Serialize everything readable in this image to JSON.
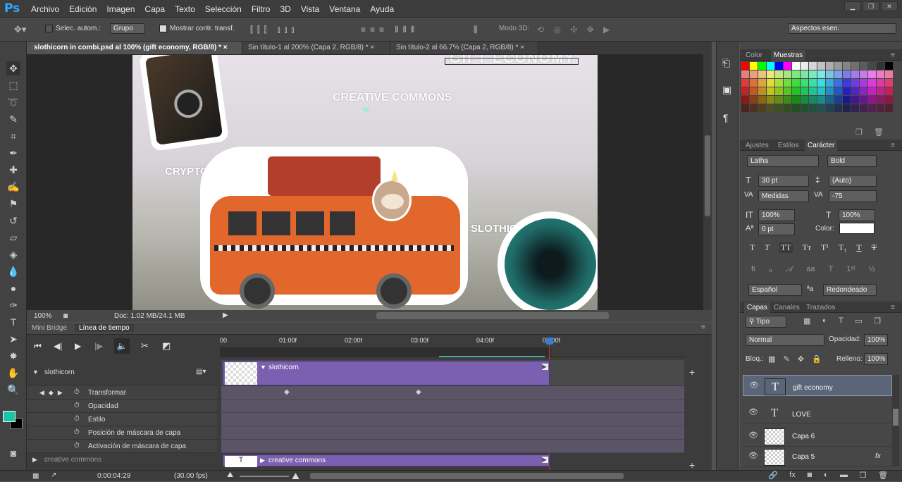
{
  "app": {
    "logo": "Ps"
  },
  "menu": [
    "Archivo",
    "Edición",
    "Imagen",
    "Capa",
    "Texto",
    "Selección",
    "Filtro",
    "3D",
    "Vista",
    "Ventana",
    "Ayuda"
  ],
  "options": {
    "auto_select_label": "Selec. autom.:",
    "group_value": "Grupo",
    "show_transform_label": "Mostrar contr. transf.",
    "mode3d_label": "Modo 3D:",
    "workspace": "Aspectos esen."
  },
  "doc_tabs": [
    {
      "label": "slothicorn in combi.psd al 100% (gift economy, RGB/8) *",
      "close": "×"
    },
    {
      "label": "Sin título-1 al 200% (Capa 2, RGB/8) *",
      "close": "×"
    },
    {
      "label": "Sin título-2 al 66.7% (Capa 2, RGB/8) *",
      "close": "×"
    }
  ],
  "canvas_texts": {
    "gift": "GIFT ECONOMY",
    "creative": "CREATIVE COMMONS",
    "crypto": "CRYPTOART",
    "sloth": "SLOTHICORN"
  },
  "status": {
    "zoom": "100%",
    "doc": "Doc: 1.02 MB/24.1 MB"
  },
  "timeline": {
    "tabs": [
      "Mini Bridge",
      "Línea de tiempo"
    ],
    "ruler": [
      "00",
      "01:00f",
      "02:00f",
      "03:00f",
      "04:00f",
      "05:00f"
    ],
    "group_name": "slothicorn",
    "clip1": "slothicorn",
    "clip2": "creative commons",
    "next_group": "creative commons",
    "props": [
      "Transformar",
      "Opacidad",
      "Estilo",
      "Posición de máscara de capa",
      "Activación de máscara de capa"
    ],
    "time": "0:00:04:29",
    "fps": "(30.00 fps)"
  },
  "swatch_tabs": [
    "Color",
    "Muestras"
  ],
  "adjust_tabs": [
    "Ajustes",
    "Estilos",
    "Carácter"
  ],
  "character": {
    "font": "Latha",
    "style": "Bold",
    "size": "30 pt",
    "leading": "(Auto)",
    "kerning": "Medidas",
    "tracking": "-75",
    "vscale": "100%",
    "hscale": "100%",
    "baseline": "0 pt",
    "color_label": "Color:",
    "language": "Español",
    "aa_label": "a",
    "aa": "Redondeado"
  },
  "layers_tabs": [
    "Capas",
    "Canales",
    "Trazados"
  ],
  "layers_panel": {
    "filter": "Tipo",
    "blend": "Normal",
    "opacity_label": "Opacidad:",
    "opacity": "100%",
    "lock_label": "Bloq.:",
    "fill_label": "Relleno:",
    "fill": "100%"
  },
  "layers": [
    {
      "name": "gift economy",
      "kind": "T"
    },
    {
      "name": "LOVE",
      "kind": "T"
    },
    {
      "name": "Capa 6",
      "kind": "img"
    },
    {
      "name": "Capa 5",
      "kind": "img"
    }
  ],
  "colors": {
    "fg": "#1ac5a6",
    "bg": "#000000"
  }
}
